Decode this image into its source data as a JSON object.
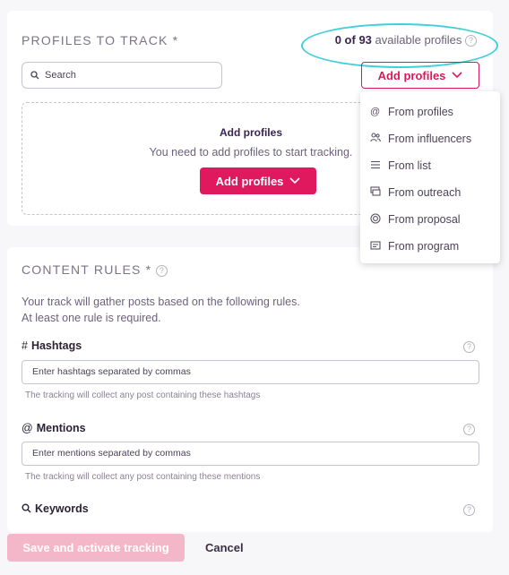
{
  "profiles_section": {
    "title": "PROFILES TO TRACK *",
    "available_count": "0 of 93",
    "available_suffix": "available profiles",
    "search_placeholder": "Search",
    "add_button_label": "Add profiles",
    "empty_title": "Add profiles",
    "empty_subtitle": "You need to add profiles to start tracking.",
    "empty_button_label": "Add profiles"
  },
  "add_profiles_menu": {
    "items": [
      {
        "label": "From profiles",
        "icon": "at-icon"
      },
      {
        "label": "From influencers",
        "icon": "people-icon"
      },
      {
        "label": "From list",
        "icon": "list-icon"
      },
      {
        "label": "From outreach",
        "icon": "outreach-icon"
      },
      {
        "label": "From proposal",
        "icon": "target-icon"
      },
      {
        "label": "From program",
        "icon": "ticket-icon"
      }
    ]
  },
  "content_rules": {
    "title": "CONTENT RULES *",
    "description_line1": "Your track will gather posts based on the following rules.",
    "description_line2": "At least one rule is required.",
    "hashtags": {
      "symbol": "#",
      "label": "Hashtags",
      "placeholder": "Enter hashtags separated by commas",
      "hint": "The tracking will collect any post containing these hashtags"
    },
    "mentions": {
      "symbol": "@",
      "label": "Mentions",
      "placeholder": "Enter mentions separated by commas",
      "hint": "The tracking will collect any post containing these mentions"
    },
    "keywords": {
      "label": "Keywords"
    }
  },
  "footer": {
    "save_label": "Save and activate tracking",
    "cancel_label": "Cancel"
  },
  "colors": {
    "accent": "#e0195e",
    "highlight_ring": "#3fd0d9",
    "save_disabled": "#f4b6c9"
  }
}
